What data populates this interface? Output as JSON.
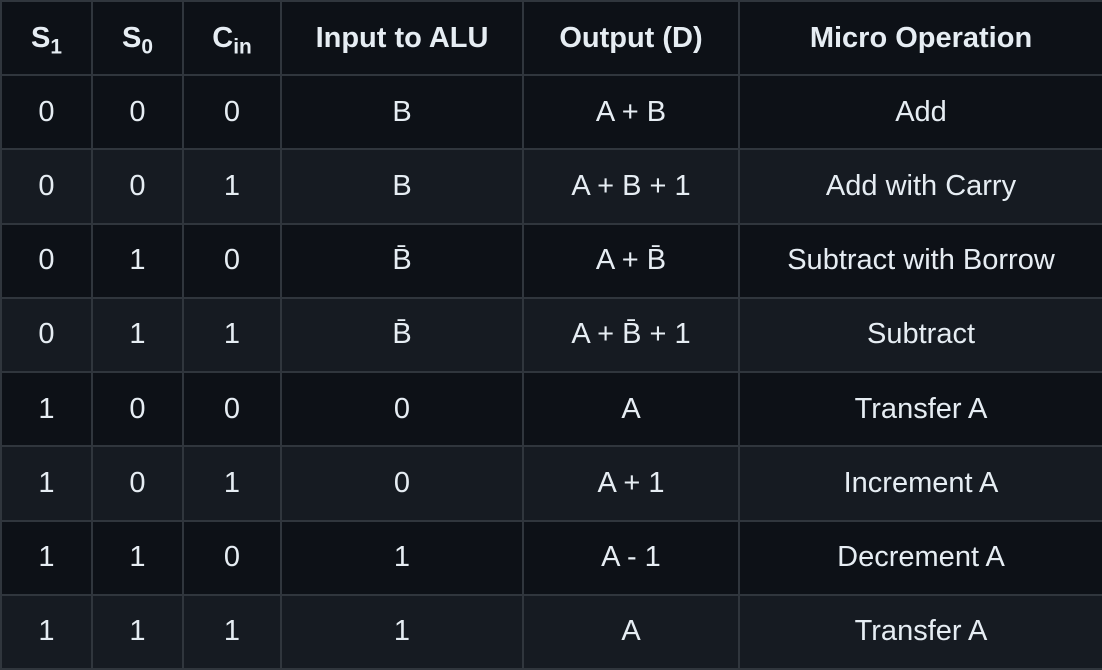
{
  "header": {
    "s1": {
      "base": "S",
      "sub": "1"
    },
    "s0": {
      "base": "S",
      "sub": "0"
    },
    "cin": {
      "base": "C",
      "sub": "in"
    },
    "input": "Input to ALU",
    "output": "Output (D)",
    "micro": "Micro Operation"
  },
  "rows": [
    {
      "s1": "0",
      "s0": "0",
      "cin": "0",
      "input": "B",
      "output": "A + B",
      "micro": "Add"
    },
    {
      "s1": "0",
      "s0": "0",
      "cin": "1",
      "input": "B",
      "output": "A + B + 1",
      "micro": "Add with Carry"
    },
    {
      "s1": "0",
      "s0": "1",
      "cin": "0",
      "input": "B̄",
      "output": "A + B̄",
      "micro": "Subtract with Borrow"
    },
    {
      "s1": "0",
      "s0": "1",
      "cin": "1",
      "input": "B̄",
      "output": "A + B̄ + 1",
      "micro": "Subtract"
    },
    {
      "s1": "1",
      "s0": "0",
      "cin": "0",
      "input": "0",
      "output": "A",
      "micro": "Transfer A"
    },
    {
      "s1": "1",
      "s0": "0",
      "cin": "1",
      "input": "0",
      "output": "A + 1",
      "micro": "Increment A"
    },
    {
      "s1": "1",
      "s0": "1",
      "cin": "0",
      "input": "1",
      "output": "A - 1",
      "micro": "Decrement A"
    },
    {
      "s1": "1",
      "s0": "1",
      "cin": "1",
      "input": "1",
      "output": "A",
      "micro": "Transfer A"
    }
  ]
}
